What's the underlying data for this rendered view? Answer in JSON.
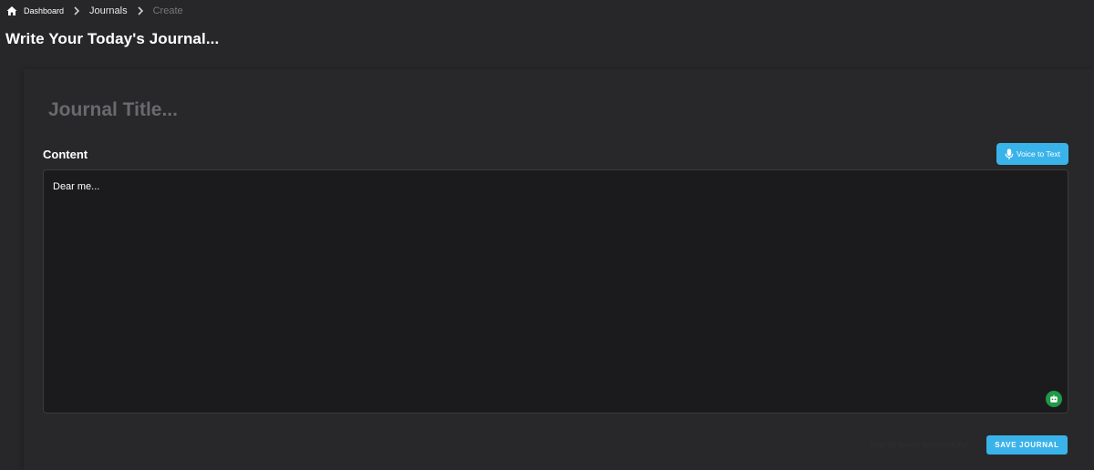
{
  "breadcrumb": {
    "home": "Dashboard",
    "section": "Journals",
    "current": "Create",
    "icons": {
      "home": "home-icon",
      "separator": "chevron-right-icon"
    }
  },
  "page": {
    "title": "Write Your Today's Journal..."
  },
  "form": {
    "title_placeholder": "Journal Title...",
    "title_value": "",
    "content_label": "Content",
    "content_placeholder": "Dear me...",
    "content_value": "",
    "voice_button": "Voice to Text",
    "voice_icon": "microphone-icon",
    "ai_icon": "robot-icon",
    "save_status": "Journal saved successfully!",
    "save_button": "SAVE JOURNAL"
  },
  "colors": {
    "background": "#272729",
    "editor_bg": "#1b1b1d",
    "accent": "#3ab3ea",
    "ai_button": "#1f9a49",
    "muted_text": "#77777b"
  }
}
